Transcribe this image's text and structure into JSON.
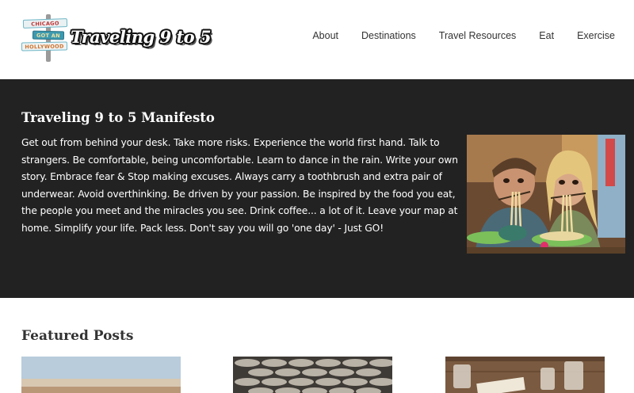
{
  "site": {
    "logo_text": "Traveling 9 to 5",
    "logo_signs": [
      "CHICAGO",
      "GOT AN",
      "HOLLYWOOD"
    ]
  },
  "nav": {
    "items": [
      "About",
      "Destinations",
      "Travel Resources",
      "Eat",
      "Exercise"
    ]
  },
  "manifesto": {
    "title": "Traveling 9 to 5 Manifesto",
    "body": "Get out from behind your desk. Take more risks. Experience the world first hand. Talk to strangers. Be comfortable, being uncomfortable. Learn to dance in the rain. Write your own story. Embrace fear & Stop making excuses. Always carry a toothbrush and extra pair of underwear. Avoid overthinking. Be driven by your passion. Be inspired by the food you eat, the people you meet and the miracles you see. Drink coffee... a lot of it. Leave your map at home. Simplify your life. Pack less. Don't say you will go 'one day' - Just GO!"
  },
  "featured": {
    "title": "Featured Posts"
  },
  "colors": {
    "band_background": "#222222",
    "page_background": "#ffffff",
    "nav_text": "#333333"
  }
}
